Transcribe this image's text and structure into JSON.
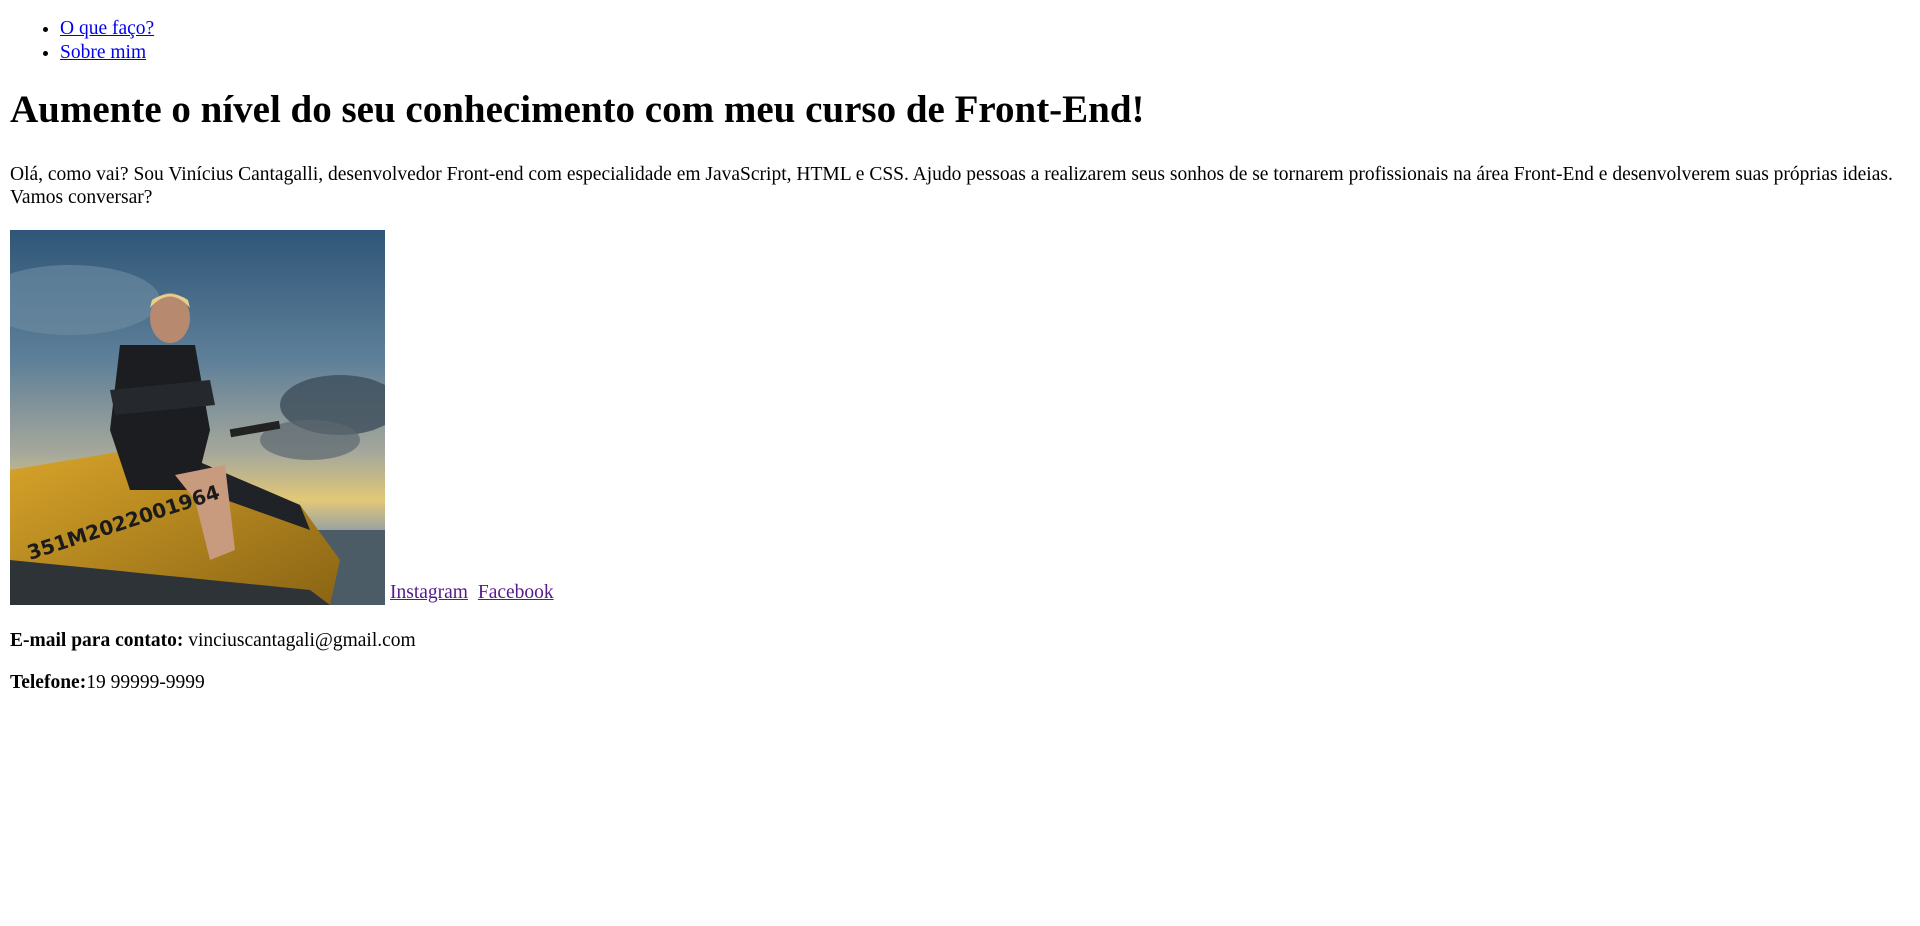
{
  "nav": {
    "items": [
      {
        "label": "O que faço?"
      },
      {
        "label": "Sobre mim"
      }
    ]
  },
  "main": {
    "title": "Aumente o nível do seu conhecimento com meu curso de Front-End!",
    "intro": "Olá, como vai? Sou Vinícius Cantagalli, desenvolvedor Front-end com especialidade em JavaScript, HTML e CSS. Ajudo pessoas a realizarem seus sonhos de se tornarem profissionais na área Front-End e desenvolverem suas próprias ideias. Vamos conversar?",
    "photo": {
      "icon": "profile-photo",
      "jetski_number": "351M2022001964"
    },
    "social": {
      "instagram": "Instagram",
      "facebook": "Facebook"
    },
    "contact": {
      "email_label": "E-mail para contato:",
      "email_value": "vinciuscantagali@gmail.com",
      "phone_label": "Telefone:",
      "phone_value": "19 99999-9999"
    }
  },
  "colors": {
    "link": "#0000ee",
    "visited_link": "#551a8b",
    "text": "#000000",
    "background": "#ffffff"
  }
}
